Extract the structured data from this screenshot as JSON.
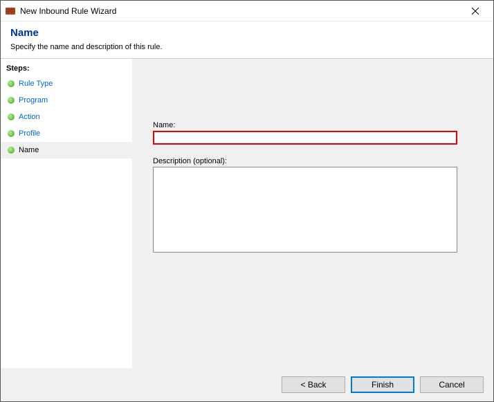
{
  "window": {
    "title": "New Inbound Rule Wizard"
  },
  "header": {
    "title": "Name",
    "subtitle": "Specify the name and description of this rule."
  },
  "sidebar": {
    "steps_label": "Steps:",
    "items": [
      {
        "label": "Rule Type"
      },
      {
        "label": "Program"
      },
      {
        "label": "Action"
      },
      {
        "label": "Profile"
      },
      {
        "label": "Name"
      }
    ],
    "current_index": 4
  },
  "form": {
    "name_label": "Name:",
    "name_value": "",
    "desc_label": "Description (optional):",
    "desc_value": ""
  },
  "buttons": {
    "back": "< Back",
    "finish": "Finish",
    "cancel": "Cancel"
  }
}
